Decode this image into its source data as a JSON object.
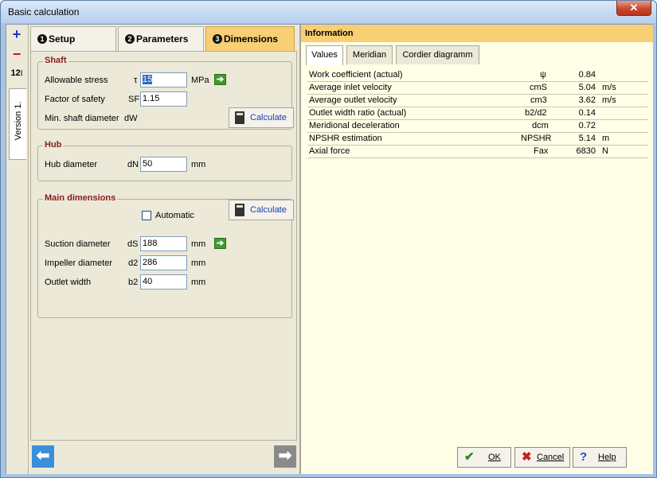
{
  "window": {
    "title": "Basic calculation",
    "close_glyph": "✕"
  },
  "toolbar": {
    "add": "+",
    "remove": "−",
    "number": "12",
    "version_tab": "Version 1."
  },
  "tabs": [
    {
      "num": "1",
      "label": "Setup"
    },
    {
      "num": "2",
      "label": "Parameters"
    },
    {
      "num": "3",
      "label": "Dimensions"
    }
  ],
  "shaft": {
    "title": "Shaft",
    "stress_label": "Allowable stress",
    "stress_sym": "τ",
    "stress_value": "15",
    "stress_unit": "MPa",
    "sf_label": "Factor of safety",
    "sf_sym": "SF",
    "sf_value": "1.15",
    "dw_label": "Min. shaft diameter",
    "dw_sym": "dW",
    "calc_label": "Calculate"
  },
  "hub": {
    "title": "Hub",
    "dn_label": "Hub diameter",
    "dn_sym": "dN",
    "dn_value": "50",
    "dn_unit": "mm"
  },
  "main": {
    "title": "Main dimensions",
    "auto_label": "Automatic",
    "calc_label": "Calculate",
    "ds_label": "Suction diameter",
    "ds_sym": "dS",
    "ds_value": "188",
    "ds_unit": "mm",
    "d2_label": "Impeller diameter",
    "d2_sym": "d2",
    "d2_value": "286",
    "d2_unit": "mm",
    "b2_label": "Outlet width",
    "b2_sym": "b2",
    "b2_value": "40",
    "b2_unit": "mm"
  },
  "info": {
    "header": "Information",
    "tabs": [
      "Values",
      "Meridian",
      "Cordier diagramm"
    ],
    "rows": [
      {
        "label": "Work coefficient (actual)",
        "sym": "ψ",
        "value": "0.84",
        "unit": ""
      },
      {
        "label": "Average inlet velocity",
        "sym": "cmS",
        "value": "5.04",
        "unit": "m/s"
      },
      {
        "label": "Average outlet velocity",
        "sym": "cm3",
        "value": "3.62",
        "unit": "m/s"
      },
      {
        "label": "Outlet width ratio (actual)",
        "sym": "b2/d2",
        "value": "0.14",
        "unit": ""
      },
      {
        "label": "Meridional deceleration",
        "sym": "dcm",
        "value": "0.72",
        "unit": ""
      },
      {
        "label": "NPSHR estimation",
        "sym": "NPSHR",
        "value": "5.14",
        "unit": "m"
      },
      {
        "label": "Axial force",
        "sym": "Fax",
        "value": "6830",
        "unit": "N"
      }
    ]
  },
  "buttons": {
    "ok": "OK",
    "cancel": "Cancel",
    "help": "Help"
  },
  "colors": {
    "accent_tab": "#f8cf72",
    "group_title": "#8b1a1a",
    "nav_blue": "#3a8fd8",
    "nav_gray": "#8a8a8a"
  }
}
